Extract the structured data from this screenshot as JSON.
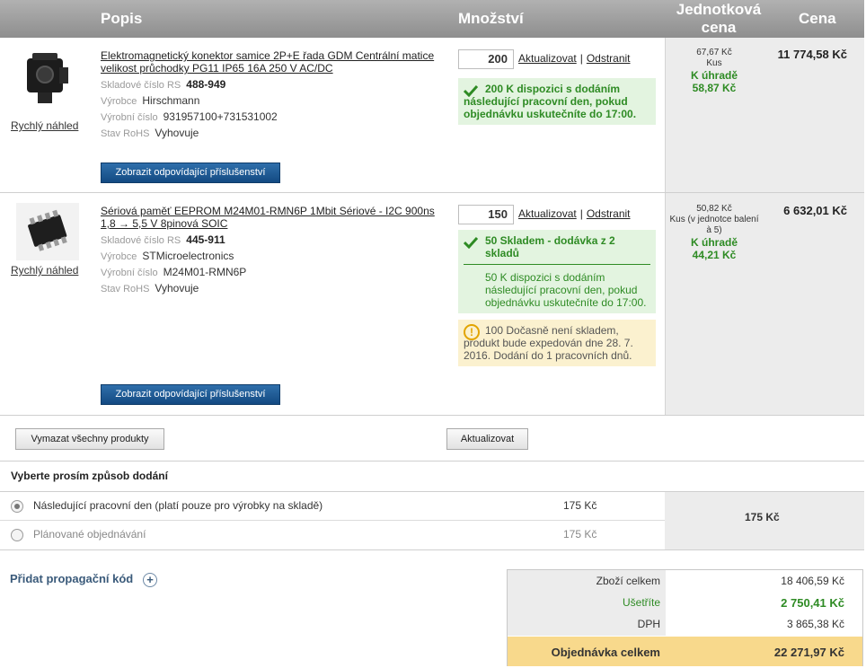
{
  "header": {
    "description": "Popis",
    "quantity": "Množství",
    "unit_price_line1": "Jednotková",
    "unit_price_line2": "cena",
    "price": "Cena"
  },
  "items": [
    {
      "title": "Elektromagnetický konektor samice 2P+E řada GDM Centrální matice velikost průchodky PG11 IP65 16A 250 V AC/DC",
      "quick_view": "Rychlý náhled",
      "specs": [
        {
          "label": "Skladové číslo RS",
          "value": "488-949"
        },
        {
          "label": "Výrobce",
          "value": "Hirschmann"
        },
        {
          "label": "Výrobní číslo",
          "value": "931957100+731531002"
        },
        {
          "label": "Stav RoHS",
          "value": "Vyhovuje"
        }
      ],
      "accessories_button": "Zobrazit odpovídající příslušenství",
      "quantity": "200",
      "update_link": "Aktualizovat",
      "separator": "|",
      "remove_link": "Odstranit",
      "stock_message": "200 K dispozici s dodáním následující pracovní den, pokud objednávku uskutečníte do 17:00.",
      "unit_price": "67,67 Kč",
      "unit": "Kus",
      "payable_label": "K úhradě",
      "payable_price": "58,87 Kč",
      "total": "11 774,58 Kč",
      "icon": "connector-product-image"
    },
    {
      "title": "Sériová paměť EEPROM M24M01-RMN6P 1Mbit Sériové - I2C 900ns 1,8 → 5,5 V 8pinová SOIC",
      "quick_view": "Rychlý náhled",
      "specs": [
        {
          "label": "Skladové číslo RS",
          "value": "445-911"
        },
        {
          "label": "Výrobce",
          "value": "STMicroelectronics"
        },
        {
          "label": "Výrobní číslo",
          "value": "M24M01-RMN6P"
        },
        {
          "label": "Stav RoHS",
          "value": "Vyhovuje"
        }
      ],
      "accessories_button": "Zobrazit odpovídající příslušenství",
      "quantity": "150",
      "update_link": "Aktualizovat",
      "separator": "|",
      "remove_link": "Odstranit",
      "stock_heading": "50 Skladem - dodávka z 2 skladů",
      "stock_message": "50 K dispozici s dodáním následující pracovní den, pokud objednávku uskutečníte do 17:00.",
      "warning_message": "100 Dočasně není skladem, produkt bude expedován dne 28. 7. 2016. Dodání do 1 pracovních dnů.",
      "unit_price": "50,82 Kč",
      "unit": "Kus (v jednotce balení à 5)",
      "payable_label": "K úhradě",
      "payable_price": "44,21 Kč",
      "total": "6 632,01 Kč",
      "icon": "chip-product-image"
    }
  ],
  "actions": {
    "clear_all": "Vymazat všechny produkty",
    "update": "Aktualizovat"
  },
  "delivery": {
    "title": "Vyberte prosím způsob dodání",
    "options": [
      {
        "label": "Následující pracovní den (platí pouze pro výrobky na skladě)",
        "price": "175 Kč",
        "selected": true
      },
      {
        "label": "Plánované objednávání",
        "price": "175 Kč",
        "selected": false
      }
    ],
    "selected_total": "175 Kč"
  },
  "promo": {
    "label": "Přidat propagační kód",
    "icon": "plus-circle-icon"
  },
  "summary": {
    "goods_label": "Zboží celkem",
    "goods_value": "18 406,59 Kč",
    "savings_label": "Ušetříte",
    "savings_value": "2 750,41 Kč",
    "vat_label": "DPH",
    "vat_value": "3 865,38 Kč",
    "order_total_label": "Objednávka celkem",
    "order_total_value": "22 271,97 Kč"
  },
  "colors": {
    "header_gray": "#9f9f9f",
    "accent_blue": "#1f5c96",
    "stock_green": "#2e8b24",
    "stock_bg": "#e3f4e0",
    "warning_bg": "#fbf1cf",
    "total_bg": "#f8d98c"
  }
}
